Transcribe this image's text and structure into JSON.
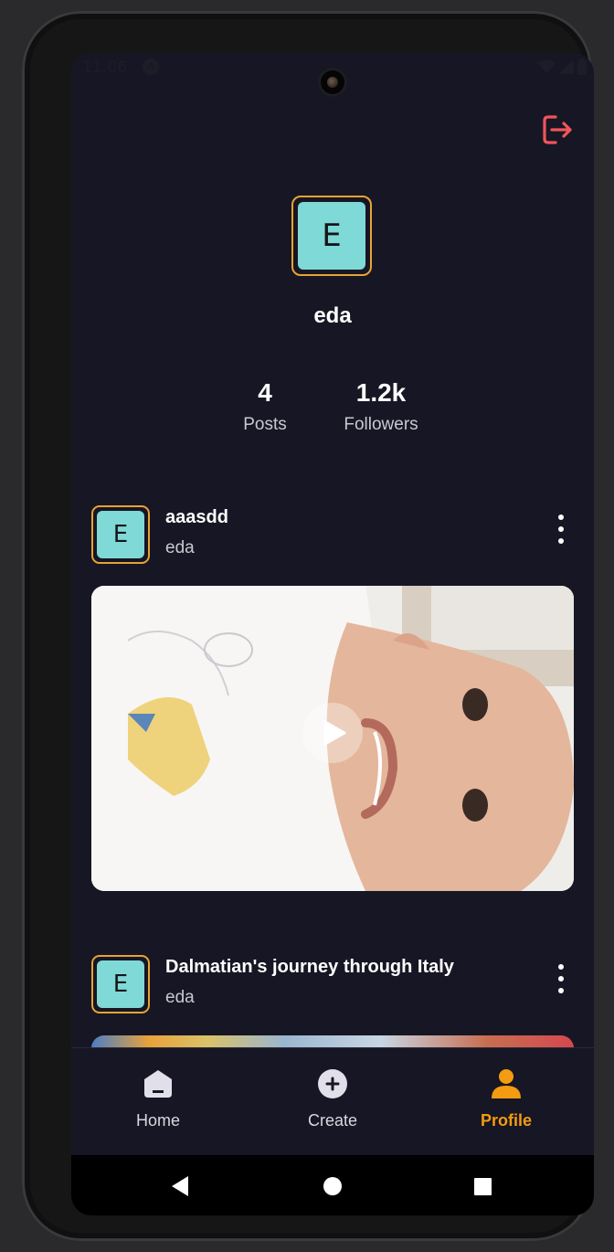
{
  "status_bar": {
    "time": "11:06",
    "a_badge": "A"
  },
  "profile": {
    "avatar_letter": "E",
    "username": "eda"
  },
  "stats": [
    {
      "value": "4",
      "label": "Posts"
    },
    {
      "value": "1.2k",
      "label": "Followers"
    }
  ],
  "posts": [
    {
      "avatar_letter": "E",
      "title": "aaasdd",
      "author": "eda",
      "media_type": "video"
    },
    {
      "avatar_letter": "E",
      "title": "Dalmatian's journey through Italy",
      "author": "eda",
      "media_type": "image"
    }
  ],
  "bottom_nav": {
    "home": "Home",
    "create": "Create",
    "profile": "Profile",
    "active": "profile"
  },
  "colors": {
    "background": "#171624",
    "accent": "#f39c12",
    "avatar_fill": "#7fd9d6",
    "avatar_border": "#e8a334",
    "logout": "#f0555a"
  },
  "icons": [
    "logout-icon",
    "more-vertical-icon",
    "play-icon",
    "home-icon",
    "plus-circle-icon",
    "person-icon",
    "back-triangle-icon",
    "home-circle-icon",
    "recents-square-icon"
  ]
}
